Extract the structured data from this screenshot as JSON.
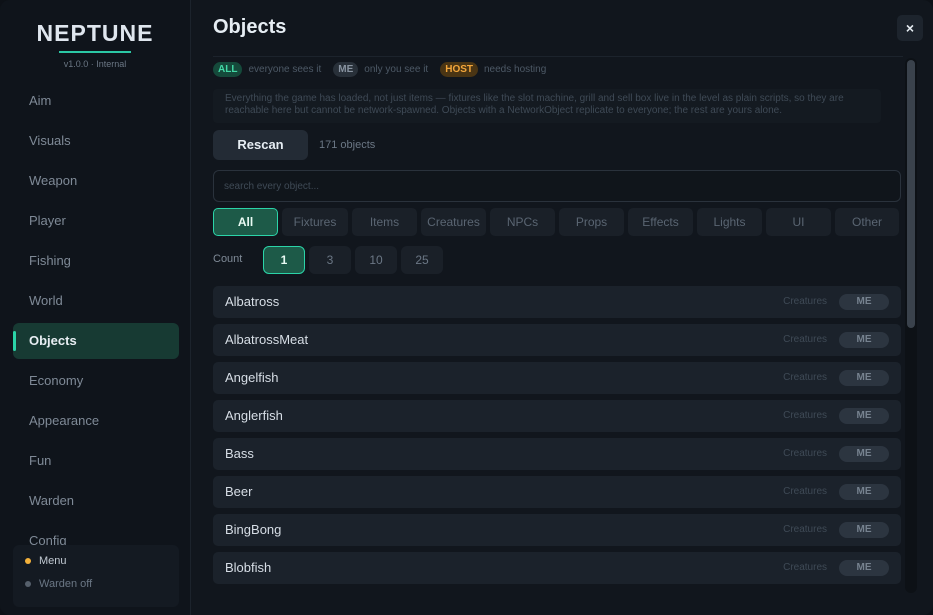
{
  "sidebar": {
    "brand": "NEPTUNE",
    "version": "v1.0.0 · Internal",
    "items": [
      {
        "label": "Aim"
      },
      {
        "label": "Visuals"
      },
      {
        "label": "Weapon"
      },
      {
        "label": "Player"
      },
      {
        "label": "Fishing"
      },
      {
        "label": "World"
      },
      {
        "label": "Objects"
      },
      {
        "label": "Economy"
      },
      {
        "label": "Appearance"
      },
      {
        "label": "Fun"
      },
      {
        "label": "Warden"
      },
      {
        "label": "Config"
      }
    ],
    "active": "Objects",
    "footer": [
      {
        "label": "Menu",
        "color": "#f3b13b"
      },
      {
        "label": "Warden off",
        "color": "#56606c"
      }
    ]
  },
  "header": {
    "title": "Objects",
    "close": "×"
  },
  "legend": [
    {
      "tag": "ALL",
      "text": "everyone sees it"
    },
    {
      "tag": "ME",
      "text": "only you see it"
    },
    {
      "tag": "HOST",
      "text": "needs hosting"
    }
  ],
  "info": "Everything the game has loaded, not just items — fixtures like the slot machine, grill and sell box live in the level as plain scripts, so they are reachable here but cannot be network-spawned. Objects with a NetworkObject replicate to everyone; the rest are yours alone.",
  "rescan": {
    "label": "Rescan",
    "count": "171 objects"
  },
  "search": {
    "placeholder": "search every object..."
  },
  "filters": [
    "All",
    "Fixtures",
    "Items",
    "Creatures",
    "NPCs",
    "Props",
    "Effects",
    "Lights",
    "UI",
    "Other"
  ],
  "count": {
    "label": "Count",
    "options": [
      "1",
      "3",
      "10",
      "25"
    ]
  },
  "objects": [
    {
      "name": "Albatross",
      "category": "Creatures",
      "badge": "ME"
    },
    {
      "name": "AlbatrossMeat",
      "category": "Creatures",
      "badge": "ME"
    },
    {
      "name": "Angelfish",
      "category": "Creatures",
      "badge": "ME"
    },
    {
      "name": "Anglerfish",
      "category": "Creatures",
      "badge": "ME"
    },
    {
      "name": "Bass",
      "category": "Creatures",
      "badge": "ME"
    },
    {
      "name": "Beer",
      "category": "Creatures",
      "badge": "ME"
    },
    {
      "name": "BingBong",
      "category": "Creatures",
      "badge": "ME"
    },
    {
      "name": "Blobfish",
      "category": "Creatures",
      "badge": "ME"
    }
  ]
}
